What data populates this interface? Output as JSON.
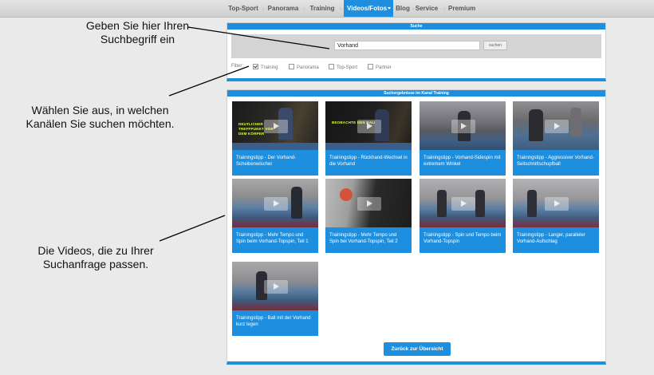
{
  "nav": {
    "items": [
      "Top-Sport",
      "Panorama",
      "Training",
      "Videos/Fotos",
      "Blog",
      "Service",
      "Premium"
    ],
    "active": "Videos/Fotos"
  },
  "search": {
    "header": "Suche",
    "value": "Vorhand",
    "button_label": "suchen",
    "filter_label": "Filter:",
    "filters": [
      {
        "label": "Training",
        "checked": true
      },
      {
        "label": "Panorama",
        "checked": false
      },
      {
        "label": "Top-Sport",
        "checked": false
      },
      {
        "label": "Partner",
        "checked": false
      }
    ]
  },
  "results": {
    "header": "Suchergebnisse im Kanal Training",
    "videos": [
      {
        "title": "Trainingstipp - Der Vorhand-Scheibenwischer",
        "overlay": "DEUTLICHER TREFFPUNKT VOR DEM KÖRPER"
      },
      {
        "title": "Trainingstipp - Rückhand-Wechsel in die Vorhand",
        "overlay": "BEOBACHTE DEN BALL"
      },
      {
        "title": "Trainingstipp - Vorhand-Sidespin mit extremem Winkel",
        "overlay": ""
      },
      {
        "title": "Trainingstipp - Aggressiver Vorhand-Seitschnittschupfball",
        "overlay": ""
      },
      {
        "title": "Trainingstipp - Mehr Tempo und Spin beim Vorhand-Topspin, Teil 1",
        "overlay": ""
      },
      {
        "title": "Trainingstipp - Mehr Tempo und Spin bei Vorhand-Topspin, Teil 2",
        "overlay": ""
      },
      {
        "title": "Trainingstipp - Spin und Tempo beim Vorhand-Topspin",
        "overlay": ""
      },
      {
        "title": "Trainingstipp - Langer, paralleler Vorhand-Aufschlag",
        "overlay": ""
      },
      {
        "title": "Trainingstipp - Ball mit der Vorhand kurz legen",
        "overlay": ""
      }
    ],
    "back_button": "Zurück zur Übersicht"
  },
  "annotations": {
    "search_hint": "Geben Sie hier Ihren Suchbegriff ein",
    "filter_hint": "Wählen Sie aus, in welchen Kanälen Sie suchen möchten.",
    "results_hint": "Die Videos, die zu Ihrer Suchanfrage passen."
  },
  "colors": {
    "accent": "#1e8fdf",
    "background": "#eaeaea"
  }
}
